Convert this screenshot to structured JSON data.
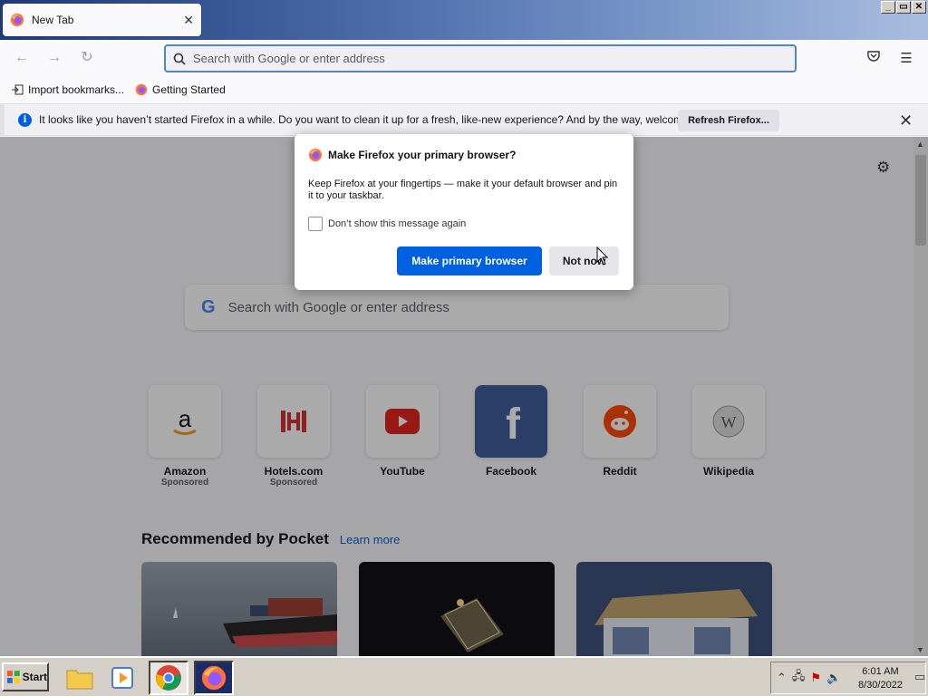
{
  "window": {
    "tab_title": "New Tab",
    "tab_close": "✕",
    "controls": [
      "_",
      "▭",
      "✕"
    ]
  },
  "navbar": {
    "url_placeholder": "Search with Google or enter address",
    "icons": [
      "back-arrow-icon",
      "forward-arrow-icon",
      "reload-icon",
      "pocket-icon",
      "hamburger-menu-icon"
    ]
  },
  "bookmarks": [
    {
      "label": "Import bookmarks..."
    },
    {
      "label": "Getting Started"
    }
  ],
  "notification": {
    "message": "It looks like you haven’t started Firefox in a while. Do you want to clean it up for a fresh, like-new experience? And by the way, welcome back!",
    "button": "Refresh Firefox..."
  },
  "newtab": {
    "search_placeholder": "Search with Google or enter address",
    "google_letter": "G",
    "tiles": [
      {
        "name": "Amazon",
        "sponsored": "Sponsored"
      },
      {
        "name": "Hotels.com",
        "sponsored": "Sponsored"
      },
      {
        "name": "YouTube",
        "sponsored": ""
      },
      {
        "name": "Facebook",
        "sponsored": ""
      },
      {
        "name": "Reddit",
        "sponsored": ""
      },
      {
        "name": "Wikipedia",
        "sponsored": ""
      }
    ],
    "pocket_heading": "Recommended by Pocket",
    "pocket_learn_more": "Learn more"
  },
  "dialog": {
    "title": "Make Firefox your primary browser?",
    "body": "Keep Firefox at your fingertips — make it your default browser and pin it to your taskbar.",
    "checkbox_label": "Don’t show this message again",
    "primary_button": "Make primary browser",
    "secondary_button": "Not now"
  },
  "taskbar": {
    "start_label": "Start",
    "time": "6:01 AM",
    "date": "8/30/2022"
  },
  "colors": {
    "accent_blue": "#0061e0",
    "titlebar_start": "#1f3a78"
  }
}
